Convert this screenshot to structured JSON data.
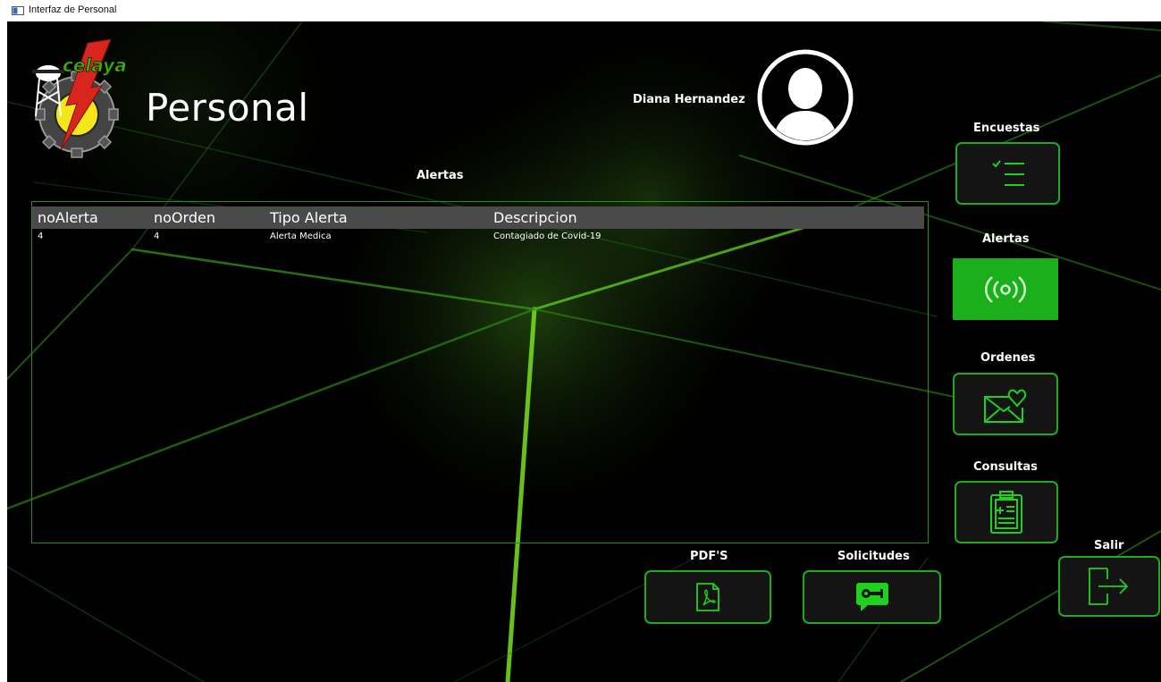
{
  "window": {
    "title": "Interfaz de Personal"
  },
  "logo": {
    "text": "celaya"
  },
  "page": {
    "title": "Personal"
  },
  "user": {
    "name": "Diana Hernandez"
  },
  "section": {
    "title": "Alertas"
  },
  "table": {
    "columns": [
      "noAlerta",
      "noOrden",
      "Tipo Alerta",
      "Descripcion"
    ],
    "rows": [
      [
        "4",
        "4",
        "Alerta Medica",
        "Contagiado de Covid-19"
      ]
    ]
  },
  "sidebar": {
    "encuestas": "Encuestas",
    "alertas": "Alertas",
    "ordenes": "Ordenes",
    "consultas": "Consultas"
  },
  "bottom": {
    "pdfs": "PDF'S",
    "solicitudes": "Solicitudes",
    "salir": "Salir"
  },
  "icons": {
    "encuestas": "checklist-icon",
    "alertas": "broadcast-icon",
    "ordenes": "envelope-heart-icon",
    "consultas": "clipboard-icon",
    "pdfs": "pdf-file-icon",
    "solicitudes": "chat-wrench-icon",
    "salir": "exit-icon"
  },
  "colors": {
    "accent": "#1faa1f",
    "active": "#1bb01b",
    "background": "#000000",
    "table_header": "#4a4a4a"
  }
}
